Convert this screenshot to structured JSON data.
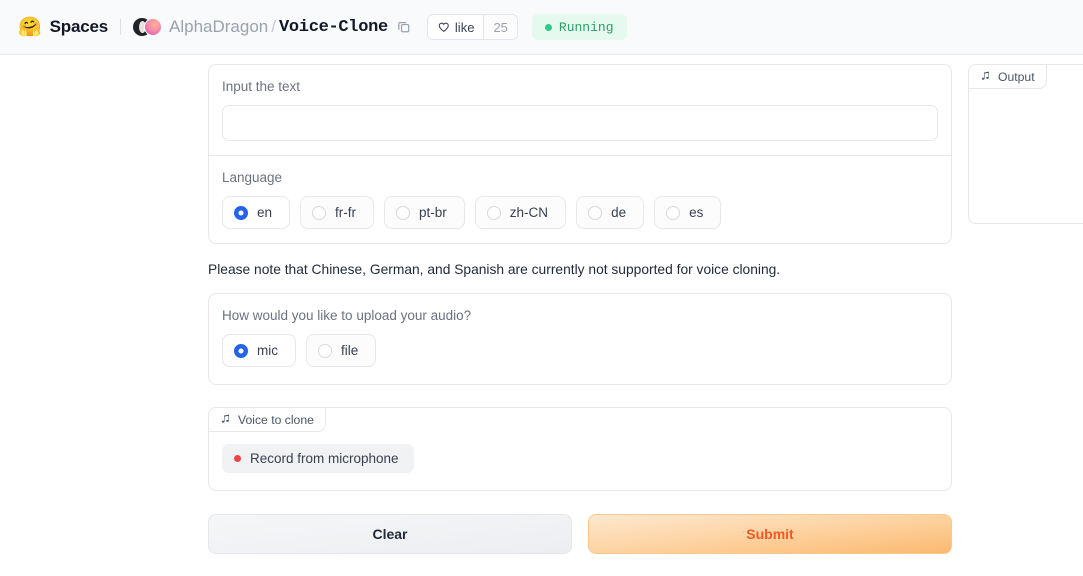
{
  "header": {
    "logo_icon": "hugging-face-logo",
    "spaces_label": "Spaces",
    "owner": "AlphaDragon",
    "slash": "/",
    "repo": "Voice-Clone",
    "copy_icon": "copy-icon",
    "like_icon": "heart-icon",
    "like_label": "like",
    "like_count": "25",
    "status_label": "Running",
    "status_color": "#2ecc8a"
  },
  "form": {
    "text_input": {
      "label": "Input the text",
      "value": "",
      "placeholder": ""
    },
    "language": {
      "label": "Language",
      "selected": "en",
      "options": [
        {
          "label": "en",
          "selected": true
        },
        {
          "label": "fr-fr",
          "selected": false
        },
        {
          "label": "pt-br",
          "selected": false
        },
        {
          "label": "zh-CN",
          "selected": false
        },
        {
          "label": "de",
          "selected": false
        },
        {
          "label": "es",
          "selected": false
        }
      ]
    },
    "note": "Please note that Chinese, German, and Spanish are currently not supported for voice cloning.",
    "upload_mode": {
      "label": "How would you like to upload your audio?",
      "selected": "mic",
      "options": [
        {
          "label": "mic",
          "selected": true
        },
        {
          "label": "file",
          "selected": false
        }
      ]
    },
    "voice_to_clone": {
      "tab_icon": "music-note-icon",
      "tab_label": "Voice to clone",
      "record_icon": "record-dot-icon",
      "record_label": "Record from microphone"
    },
    "actions": {
      "clear_label": "Clear",
      "submit_label": "Submit",
      "submit_color": "#f05a22"
    }
  },
  "output": {
    "tab_icon": "music-note-icon",
    "tab_label": "Output"
  }
}
